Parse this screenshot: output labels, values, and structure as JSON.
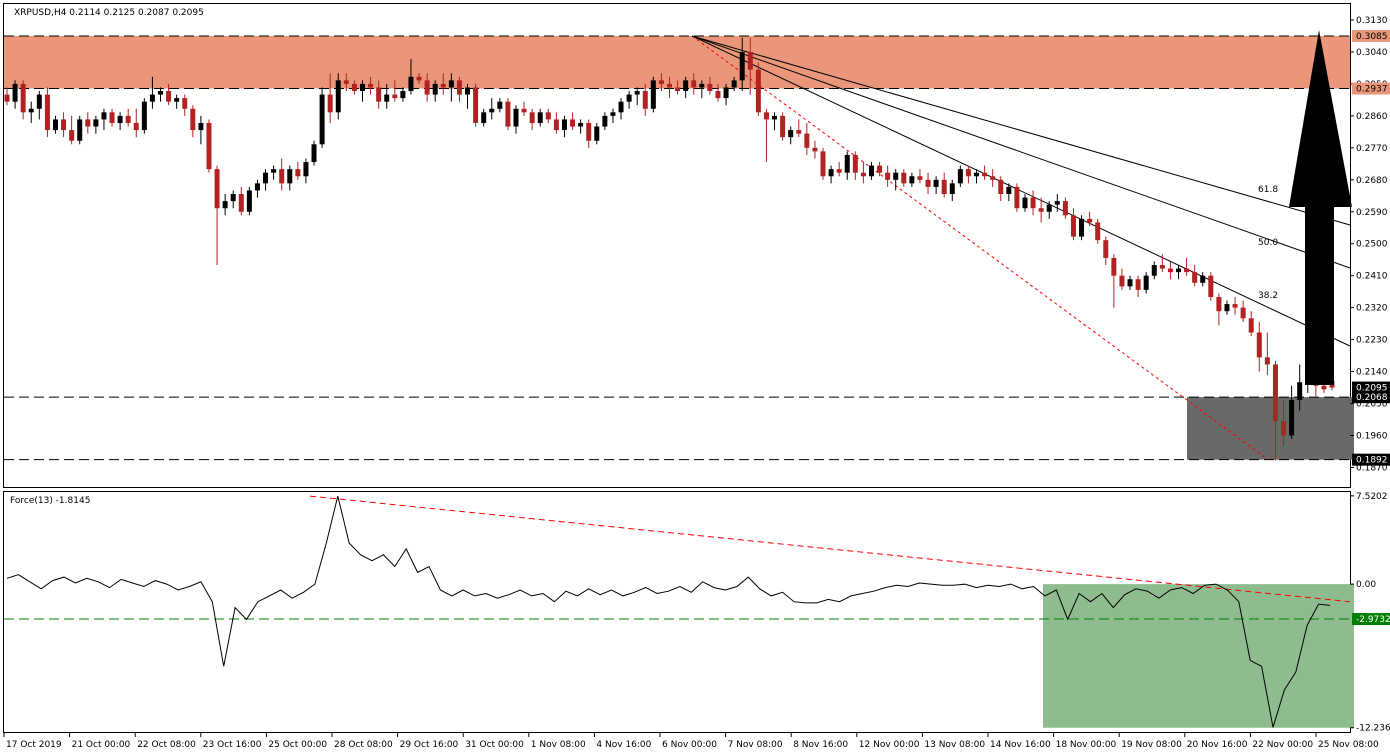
{
  "chart_data": [
    {
      "type": "candlestick",
      "title": "XRPUSD,H4  0.2114 0.2125 0.2087 0.2095",
      "ylim": [
        0.1815,
        0.3175
      ],
      "ytick_values": [
        0.313,
        0.304,
        0.295,
        0.286,
        0.277,
        0.268,
        0.259,
        0.25,
        0.241,
        0.232,
        0.223,
        0.214,
        0.205,
        0.196,
        0.187
      ],
      "ytick_labels": [
        "0.3130",
        "0.3040",
        "0.2950",
        "0.2860",
        "0.2770",
        "0.2680",
        "0.2590",
        "0.2500",
        "0.2410",
        "0.2320",
        "0.2230",
        "0.2140",
        "0.2050",
        "0.1960",
        "0.1870"
      ],
      "xtick_labels": [
        "17 Oct 2019",
        "21 Oct 00:00",
        "22 Oct 08:00",
        "23 Oct 16:00",
        "25 Oct 00:00",
        "28 Oct 08:00",
        "29 Oct 16:00",
        "31 Oct 00:00",
        "1 Nov 08:00",
        "4 Nov 16:00",
        "6 Nov 00:00",
        "7 Nov 08:00",
        "8 Nov 16:00",
        "12 Nov 00:00",
        "13 Nov 08:00",
        "14 Nov 16:00",
        "18 Nov 00:00",
        "19 Nov 08:00",
        "20 Nov 16:00",
        "22 Nov 00:00",
        "25 Nov 08:00"
      ],
      "resistance_zone": {
        "from": 0.2937,
        "to": 0.3085,
        "color": "#e9967a"
      },
      "support_zone": {
        "from": 0.1892,
        "to": 0.2068,
        "color": "#696969"
      },
      "price_markers": [
        {
          "label": "0.3085",
          "value": 0.3085,
          "color": "#e9967a"
        },
        {
          "label": "0.2937",
          "value": 0.2937,
          "color": "#e9967a"
        },
        {
          "label": "0.2095",
          "value": 0.2095,
          "color": "#000000"
        },
        {
          "label": "0.2068",
          "value": 0.2068,
          "color": "#000000"
        },
        {
          "label": "0.1892",
          "value": 0.1892,
          "color": "#000000"
        }
      ],
      "fib_levels": [
        "38.2",
        "50.0",
        "61.8"
      ],
      "arrow": "up",
      "candles": [
        [
          0.292,
          0.294,
          0.289,
          0.29
        ],
        [
          0.29,
          0.296,
          0.288,
          0.295
        ],
        [
          0.295,
          0.296,
          0.285,
          0.287
        ],
        [
          0.287,
          0.29,
          0.284,
          0.288
        ],
        [
          0.288,
          0.293,
          0.285,
          0.292
        ],
        [
          0.292,
          0.294,
          0.28,
          0.282
        ],
        [
          0.282,
          0.286,
          0.281,
          0.285
        ],
        [
          0.285,
          0.287,
          0.28,
          0.282
        ],
        [
          0.282,
          0.286,
          0.278,
          0.279
        ],
        [
          0.279,
          0.286,
          0.278,
          0.285
        ],
        [
          0.285,
          0.287,
          0.281,
          0.283
        ],
        [
          0.283,
          0.286,
          0.281,
          0.285
        ],
        [
          0.285,
          0.288,
          0.282,
          0.287
        ],
        [
          0.287,
          0.288,
          0.283,
          0.284
        ],
        [
          0.284,
          0.287,
          0.282,
          0.286
        ],
        [
          0.286,
          0.288,
          0.283,
          0.284
        ],
        [
          0.284,
          0.288,
          0.28,
          0.282
        ],
        [
          0.282,
          0.291,
          0.281,
          0.29
        ],
        [
          0.29,
          0.297,
          0.288,
          0.292
        ],
        [
          0.292,
          0.294,
          0.29,
          0.293
        ],
        [
          0.293,
          0.295,
          0.289,
          0.29
        ],
        [
          0.29,
          0.292,
          0.288,
          0.291
        ],
        [
          0.291,
          0.292,
          0.286,
          0.288
        ],
        [
          0.288,
          0.289,
          0.28,
          0.282
        ],
        [
          0.282,
          0.286,
          0.278,
          0.284
        ],
        [
          0.284,
          0.285,
          0.27,
          0.271
        ],
        [
          0.271,
          0.272,
          0.244,
          0.26
        ],
        [
          0.26,
          0.264,
          0.258,
          0.262
        ],
        [
          0.262,
          0.265,
          0.26,
          0.264
        ],
        [
          0.264,
          0.266,
          0.258,
          0.259
        ],
        [
          0.259,
          0.266,
          0.258,
          0.265
        ],
        [
          0.265,
          0.268,
          0.263,
          0.267
        ],
        [
          0.267,
          0.271,
          0.265,
          0.27
        ],
        [
          0.27,
          0.272,
          0.268,
          0.271
        ],
        [
          0.271,
          0.274,
          0.265,
          0.267
        ],
        [
          0.267,
          0.272,
          0.265,
          0.271
        ],
        [
          0.271,
          0.273,
          0.268,
          0.269
        ],
        [
          0.269,
          0.274,
          0.267,
          0.273
        ],
        [
          0.273,
          0.279,
          0.272,
          0.278
        ],
        [
          0.278,
          0.294,
          0.277,
          0.292
        ],
        [
          0.292,
          0.298,
          0.284,
          0.287
        ],
        [
          0.287,
          0.298,
          0.285,
          0.296
        ],
        [
          0.296,
          0.298,
          0.293,
          0.295
        ],
        [
          0.295,
          0.296,
          0.292,
          0.293
        ],
        [
          0.293,
          0.296,
          0.29,
          0.295
        ],
        [
          0.295,
          0.297,
          0.292,
          0.294
        ],
        [
          0.294,
          0.296,
          0.288,
          0.29
        ],
        [
          0.29,
          0.295,
          0.288,
          0.292
        ],
        [
          0.292,
          0.296,
          0.29,
          0.291
        ],
        [
          0.291,
          0.294,
          0.29,
          0.293
        ],
        [
          0.293,
          0.302,
          0.292,
          0.297
        ],
        [
          0.297,
          0.298,
          0.295,
          0.296
        ],
        [
          0.296,
          0.298,
          0.29,
          0.292
        ],
        [
          0.292,
          0.296,
          0.29,
          0.295
        ],
        [
          0.295,
          0.298,
          0.292,
          0.294
        ],
        [
          0.294,
          0.298,
          0.29,
          0.296
        ],
        [
          0.296,
          0.297,
          0.29,
          0.292
        ],
        [
          0.292,
          0.295,
          0.288,
          0.294
        ],
        [
          0.294,
          0.295,
          0.283,
          0.284
        ],
        [
          0.284,
          0.288,
          0.283,
          0.287
        ],
        [
          0.287,
          0.291,
          0.285,
          0.288
        ],
        [
          0.288,
          0.291,
          0.287,
          0.29
        ],
        [
          0.29,
          0.291,
          0.282,
          0.283
        ],
        [
          0.283,
          0.289,
          0.281,
          0.288
        ],
        [
          0.288,
          0.29,
          0.286,
          0.287
        ],
        [
          0.287,
          0.288,
          0.282,
          0.284
        ],
        [
          0.284,
          0.288,
          0.283,
          0.287
        ],
        [
          0.287,
          0.288,
          0.284,
          0.285
        ],
        [
          0.285,
          0.287,
          0.281,
          0.282
        ],
        [
          0.282,
          0.286,
          0.28,
          0.285
        ],
        [
          0.285,
          0.287,
          0.282,
          0.283
        ],
        [
          0.283,
          0.285,
          0.281,
          0.284
        ],
        [
          0.284,
          0.285,
          0.277,
          0.279
        ],
        [
          0.279,
          0.284,
          0.278,
          0.283
        ],
        [
          0.283,
          0.287,
          0.282,
          0.286
        ],
        [
          0.286,
          0.288,
          0.284,
          0.287
        ],
        [
          0.287,
          0.291,
          0.285,
          0.29
        ],
        [
          0.29,
          0.293,
          0.288,
          0.292
        ],
        [
          0.292,
          0.294,
          0.289,
          0.293
        ],
        [
          0.293,
          0.295,
          0.286,
          0.288
        ],
        [
          0.288,
          0.297,
          0.287,
          0.296
        ],
        [
          0.296,
          0.298,
          0.293,
          0.295
        ],
        [
          0.295,
          0.297,
          0.291,
          0.294
        ],
        [
          0.294,
          0.296,
          0.292,
          0.293
        ],
        [
          0.293,
          0.297,
          0.291,
          0.296
        ],
        [
          0.296,
          0.298,
          0.292,
          0.294
        ],
        [
          0.294,
          0.296,
          0.291,
          0.295
        ],
        [
          0.295,
          0.297,
          0.292,
          0.293
        ],
        [
          0.293,
          0.295,
          0.29,
          0.291
        ],
        [
          0.291,
          0.295,
          0.289,
          0.294
        ],
        [
          0.294,
          0.297,
          0.293,
          0.296
        ],
        [
          0.296,
          0.308,
          0.293,
          0.304
        ],
        [
          0.304,
          0.308,
          0.292,
          0.299
        ],
        [
          0.299,
          0.301,
          0.286,
          0.287
        ],
        [
          0.287,
          0.288,
          0.273,
          0.285
        ],
        [
          0.285,
          0.287,
          0.282,
          0.286
        ],
        [
          0.286,
          0.287,
          0.279,
          0.28
        ],
        [
          0.28,
          0.283,
          0.278,
          0.282
        ],
        [
          0.282,
          0.285,
          0.28,
          0.281
        ],
        [
          0.281,
          0.284,
          0.275,
          0.277
        ],
        [
          0.277,
          0.279,
          0.274,
          0.276
        ],
        [
          0.276,
          0.277,
          0.268,
          0.269
        ],
        [
          0.269,
          0.272,
          0.267,
          0.271
        ],
        [
          0.271,
          0.273,
          0.269,
          0.27
        ],
        [
          0.27,
          0.276,
          0.268,
          0.275
        ],
        [
          0.275,
          0.276,
          0.268,
          0.27
        ],
        [
          0.27,
          0.273,
          0.267,
          0.269
        ],
        [
          0.269,
          0.273,
          0.268,
          0.272
        ],
        [
          0.272,
          0.273,
          0.269,
          0.27
        ],
        [
          0.27,
          0.272,
          0.266,
          0.268
        ],
        [
          0.268,
          0.271,
          0.265,
          0.27
        ],
        [
          0.27,
          0.271,
          0.266,
          0.267
        ],
        [
          0.267,
          0.27,
          0.266,
          0.269
        ],
        [
          0.269,
          0.271,
          0.267,
          0.268
        ],
        [
          0.268,
          0.27,
          0.264,
          0.266
        ],
        [
          0.266,
          0.269,
          0.264,
          0.268
        ],
        [
          0.268,
          0.27,
          0.263,
          0.264
        ],
        [
          0.264,
          0.268,
          0.262,
          0.267
        ],
        [
          0.267,
          0.272,
          0.266,
          0.271
        ],
        [
          0.271,
          0.272,
          0.267,
          0.269
        ],
        [
          0.269,
          0.271,
          0.267,
          0.27
        ],
        [
          0.27,
          0.272,
          0.268,
          0.269
        ],
        [
          0.269,
          0.271,
          0.266,
          0.268
        ],
        [
          0.268,
          0.269,
          0.262,
          0.264
        ],
        [
          0.264,
          0.267,
          0.262,
          0.266
        ],
        [
          0.266,
          0.267,
          0.259,
          0.26
        ],
        [
          0.26,
          0.264,
          0.259,
          0.263
        ],
        [
          0.263,
          0.265,
          0.258,
          0.26
        ],
        [
          0.26,
          0.263,
          0.256,
          0.259
        ],
        [
          0.259,
          0.262,
          0.257,
          0.261
        ],
        [
          0.261,
          0.264,
          0.259,
          0.262
        ],
        [
          0.262,
          0.263,
          0.257,
          0.258
        ],
        [
          0.258,
          0.26,
          0.251,
          0.252
        ],
        [
          0.252,
          0.258,
          0.251,
          0.257
        ],
        [
          0.257,
          0.259,
          0.255,
          0.256
        ],
        [
          0.256,
          0.257,
          0.25,
          0.251
        ],
        [
          0.251,
          0.252,
          0.244,
          0.246
        ],
        [
          0.246,
          0.247,
          0.232,
          0.241
        ],
        [
          0.241,
          0.243,
          0.237,
          0.238
        ],
        [
          0.238,
          0.241,
          0.237,
          0.24
        ],
        [
          0.24,
          0.241,
          0.235,
          0.237
        ],
        [
          0.237,
          0.242,
          0.236,
          0.241
        ],
        [
          0.241,
          0.245,
          0.24,
          0.244
        ],
        [
          0.244,
          0.247,
          0.242,
          0.243
        ],
        [
          0.243,
          0.245,
          0.24,
          0.242
        ],
        [
          0.242,
          0.244,
          0.24,
          0.243
        ],
        [
          0.243,
          0.246,
          0.241,
          0.242
        ],
        [
          0.242,
          0.244,
          0.238,
          0.239
        ],
        [
          0.239,
          0.242,
          0.238,
          0.241
        ],
        [
          0.241,
          0.242,
          0.234,
          0.235
        ],
        [
          0.235,
          0.236,
          0.227,
          0.231
        ],
        [
          0.231,
          0.234,
          0.23,
          0.233
        ],
        [
          0.233,
          0.235,
          0.23,
          0.232
        ],
        [
          0.232,
          0.234,
          0.228,
          0.229
        ],
        [
          0.229,
          0.231,
          0.224,
          0.225
        ],
        [
          0.225,
          0.228,
          0.214,
          0.218
        ],
        [
          0.218,
          0.225,
          0.213,
          0.216
        ],
        [
          0.216,
          0.217,
          0.189,
          0.2
        ],
        [
          0.2,
          0.206,
          0.193,
          0.196
        ],
        [
          0.196,
          0.21,
          0.195,
          0.206
        ],
        [
          0.206,
          0.216,
          0.203,
          0.211
        ],
        [
          0.211,
          0.214,
          0.208,
          0.212
        ],
        [
          0.212,
          0.214,
          0.207,
          0.21
        ],
        [
          0.21,
          0.212,
          0.208,
          0.209
        ],
        [
          0.2114,
          0.2125,
          0.2087,
          0.2095
        ]
      ]
    },
    {
      "type": "line",
      "title": "Force(13) -1.8145",
      "ylim": [
        -12.6,
        7.85
      ],
      "ytick_labels": [
        "7.5202",
        "0.00",
        "-12.2369"
      ],
      "ytick_values": [
        7.5202,
        0.0,
        -12.2369
      ],
      "level_marker": {
        "label": "-2.9732",
        "value": -2.9732,
        "color": "#008000"
      },
      "green_zone": {
        "from": -12.2369,
        "to": 0.0,
        "color": "#8fbc8f"
      },
      "values": [
        0.5,
        0.8,
        0.2,
        -0.4,
        0.3,
        0.6,
        0.1,
        0.5,
        0.2,
        -0.3,
        0.4,
        0.1,
        -0.2,
        0.3,
        0.0,
        -0.5,
        -0.2,
        0.2,
        -1.5,
        -7.0,
        -2.0,
        -3.0,
        -1.5,
        -1.0,
        -0.5,
        -1.2,
        -0.7,
        0.0,
        3.5,
        7.5,
        3.5,
        2.5,
        2.0,
        2.5,
        1.5,
        3.0,
        1.0,
        1.5,
        -0.5,
        -1.0,
        -0.5,
        -1.0,
        -0.8,
        -1.2,
        -0.9,
        -0.5,
        -1.0,
        -0.8,
        -1.5,
        -0.6,
        -1.0,
        -0.4,
        -0.9,
        -0.5,
        -1.0,
        -0.7,
        -0.3,
        -0.8,
        -0.6,
        -0.2,
        -0.7,
        0.2,
        -0.3,
        -0.5,
        -0.2,
        0.6,
        -0.4,
        -1.0,
        -0.7,
        -1.5,
        -1.6,
        -1.6,
        -1.3,
        -1.5,
        -1.0,
        -0.8,
        -0.6,
        -0.3,
        -0.1,
        -0.2,
        0.1,
        0.0,
        -0.1,
        -0.1,
        0.0,
        -0.3,
        -0.1,
        -0.2,
        0.0,
        -0.4,
        -0.2,
        -1.0,
        -0.5,
        -3.0,
        -0.8,
        -1.5,
        -0.8,
        -2.0,
        -0.9,
        -0.4,
        -0.6,
        -1.2,
        -0.5,
        -0.3,
        -0.8,
        -0.1,
        0.0,
        -0.5,
        -1.5,
        -6.5,
        -7.0,
        -12.2,
        -9.0,
        -7.5,
        -3.5,
        -1.7,
        -1.8145
      ]
    }
  ]
}
